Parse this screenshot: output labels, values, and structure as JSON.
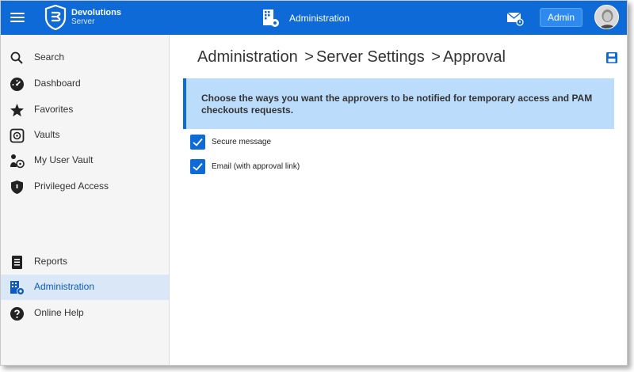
{
  "app": {
    "brand_line1": "Devolutions",
    "brand_line2": "Server",
    "section_title": "Administration",
    "user_button": "Admin"
  },
  "colors": {
    "topbar": "#0d6ad6",
    "sidebar_bg": "#f5f5f5",
    "active_bg": "#d9e7f7",
    "info_bg": "#bcdcfb",
    "checkbox": "#0d6ad6"
  },
  "sidebar": {
    "items": [
      {
        "label": "Search",
        "icon": "search-icon"
      },
      {
        "label": "Dashboard",
        "icon": "dashboard-icon"
      },
      {
        "label": "Favorites",
        "icon": "star-icon"
      },
      {
        "label": "Vaults",
        "icon": "vault-icon"
      },
      {
        "label": "My User Vault",
        "icon": "user-vault-icon"
      },
      {
        "label": "Privileged Access",
        "icon": "shield-icon"
      },
      {
        "label": "Reports",
        "icon": "report-icon"
      },
      {
        "label": "Administration",
        "icon": "administration-icon",
        "active": true
      },
      {
        "label": "Online Help",
        "icon": "help-icon"
      }
    ]
  },
  "breadcrumb": {
    "part1": "Administration",
    "part2": "Server Settings",
    "part3": "Approval",
    "separator": ">"
  },
  "info": {
    "message": "Choose the ways you want the approvers to be notified for temporary access and PAM checkouts requests."
  },
  "options": [
    {
      "label": "Secure message",
      "checked": true
    },
    {
      "label": "Email (with approval link)",
      "checked": true
    }
  ]
}
